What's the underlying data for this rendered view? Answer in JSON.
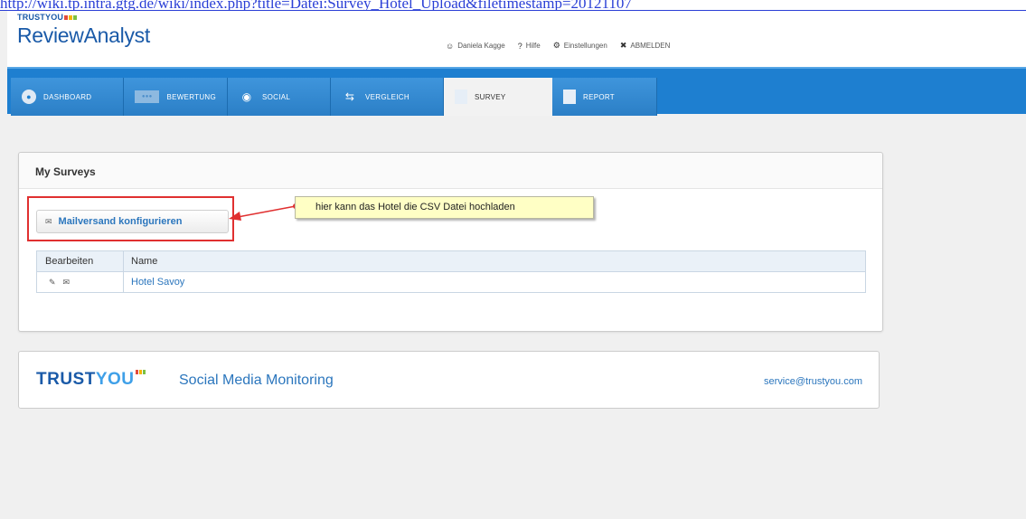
{
  "browser": {
    "url": "http://wiki.tp.intra.gtg.de/wiki/index.php?title=Datei:Survey_Hotel_Upload&filetimestamp=20121107"
  },
  "header": {
    "brand_small": "TRUSTYOU",
    "app_name": "ReviewAnalyst",
    "user": "Daniela Kagge",
    "help": "Hilfe",
    "settings": "Einstellungen",
    "logout": "ABMELDEN",
    "brand_squares": [
      "#e34b3c",
      "#f4b400",
      "#7cc142"
    ]
  },
  "nav": {
    "tabs": [
      {
        "label": "DASHBOARD",
        "icon": "speedometer-icon"
      },
      {
        "label": "BEWERTUNG",
        "icon": "rating-bar-icon"
      },
      {
        "label": "SOCIAL",
        "icon": "chat-bubble-icon"
      },
      {
        "label": "VERGLEICH",
        "icon": "compare-arrows-icon"
      },
      {
        "label": "SURVEY",
        "icon": "survey-doc-icon",
        "active": true
      },
      {
        "label": "REPORT",
        "icon": "report-doc-icon"
      }
    ]
  },
  "main": {
    "title": "My Surveys",
    "mail_button": "Mailversand konfigurieren",
    "callout": "hier kann das Hotel die CSV Datei hochladen",
    "table": {
      "columns": [
        "Bearbeiten",
        "Name"
      ],
      "rows": [
        {
          "name": "Hotel Savoy"
        }
      ]
    }
  },
  "footer": {
    "brand_a": "TRUST",
    "brand_b": "YOU",
    "tagline": "Social Media Monitoring",
    "email": "service@trustyou.com"
  },
  "colors": {
    "nav_blue": "#1e7fd0",
    "link_blue": "#2b76bd",
    "highlight_red": "#e03030",
    "callout_yellow": "#ffffc5"
  }
}
